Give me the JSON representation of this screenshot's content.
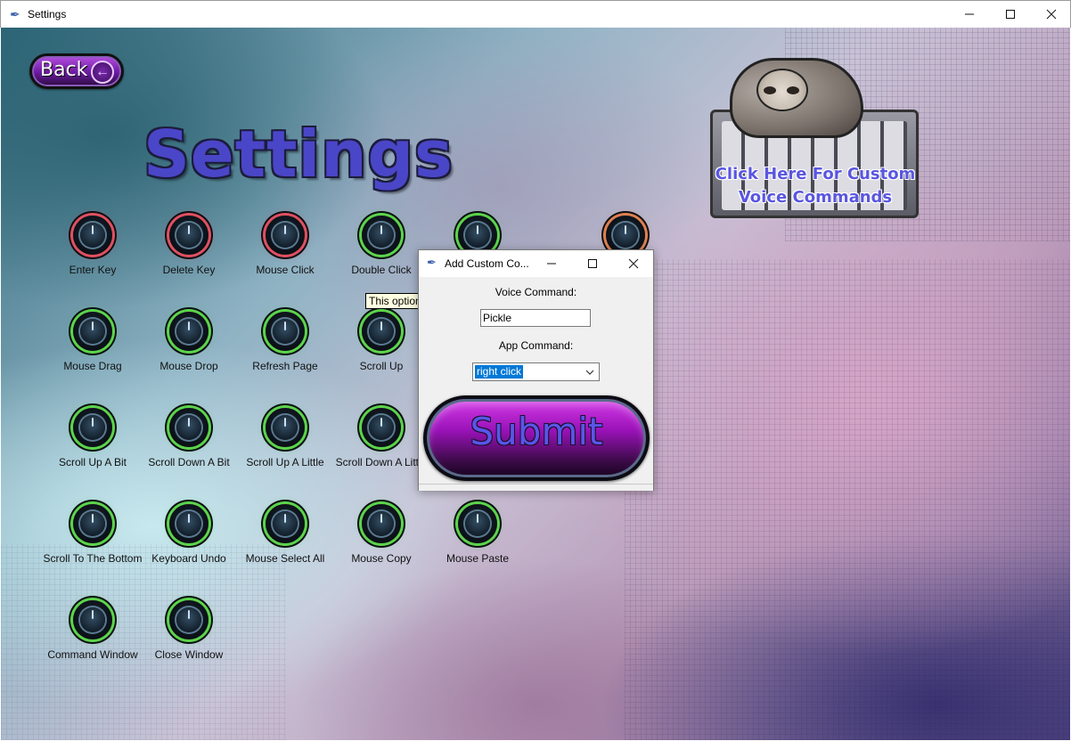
{
  "window": {
    "title": "Settings",
    "controls": {
      "minimize": "minimize-icon",
      "maximize": "maximize-icon",
      "close": "close-icon"
    }
  },
  "back_button": {
    "label": "Back",
    "icon": "arrow-left-icon"
  },
  "page_title": "Settings",
  "custom_commands": {
    "line1": "Click Here For Custom",
    "line2": "Voice Commands"
  },
  "commands": [
    {
      "label": "Enter Key",
      "state": "red"
    },
    {
      "label": "Delete Key",
      "state": "red"
    },
    {
      "label": "Mouse Click",
      "state": "red"
    },
    {
      "label": "Double Click",
      "state": "green"
    },
    {
      "label": "",
      "state": "green"
    },
    {
      "label": "",
      "state": "orange"
    },
    {
      "label": "Mouse Drag",
      "state": "green"
    },
    {
      "label": "Mouse Drop",
      "state": "green"
    },
    {
      "label": "Refresh Page",
      "state": "green"
    },
    {
      "label": "Scroll Up",
      "state": "green"
    },
    {
      "label": "Scroll Up A Bit",
      "state": "green"
    },
    {
      "label": "Scroll Down A Bit",
      "state": "green"
    },
    {
      "label": "Scroll Up A Little",
      "state": "green"
    },
    {
      "label": "Scroll Down A Little",
      "state": "green"
    },
    {
      "label": "Scroll To The Bottom",
      "state": "green"
    },
    {
      "label": "Keyboard Undo",
      "state": "green"
    },
    {
      "label": "Mouse Select All",
      "state": "green"
    },
    {
      "label": "Mouse Copy",
      "state": "green"
    },
    {
      "label": "Mouse Paste",
      "state": "green"
    },
    {
      "label": "Command Window",
      "state": "green"
    },
    {
      "label": "Close Window",
      "state": "green"
    }
  ],
  "tooltip": "This option",
  "colors": {
    "on": "#5cd44a",
    "off": "#e05060",
    "partial": "#e08050",
    "accent": "#4a46c8"
  },
  "dialog": {
    "title": "Add Custom Co...",
    "voice_label": "Voice Command:",
    "voice_value": "Pickle",
    "app_label": "App Command:",
    "app_value": "right click",
    "submit_label": "Submit"
  }
}
